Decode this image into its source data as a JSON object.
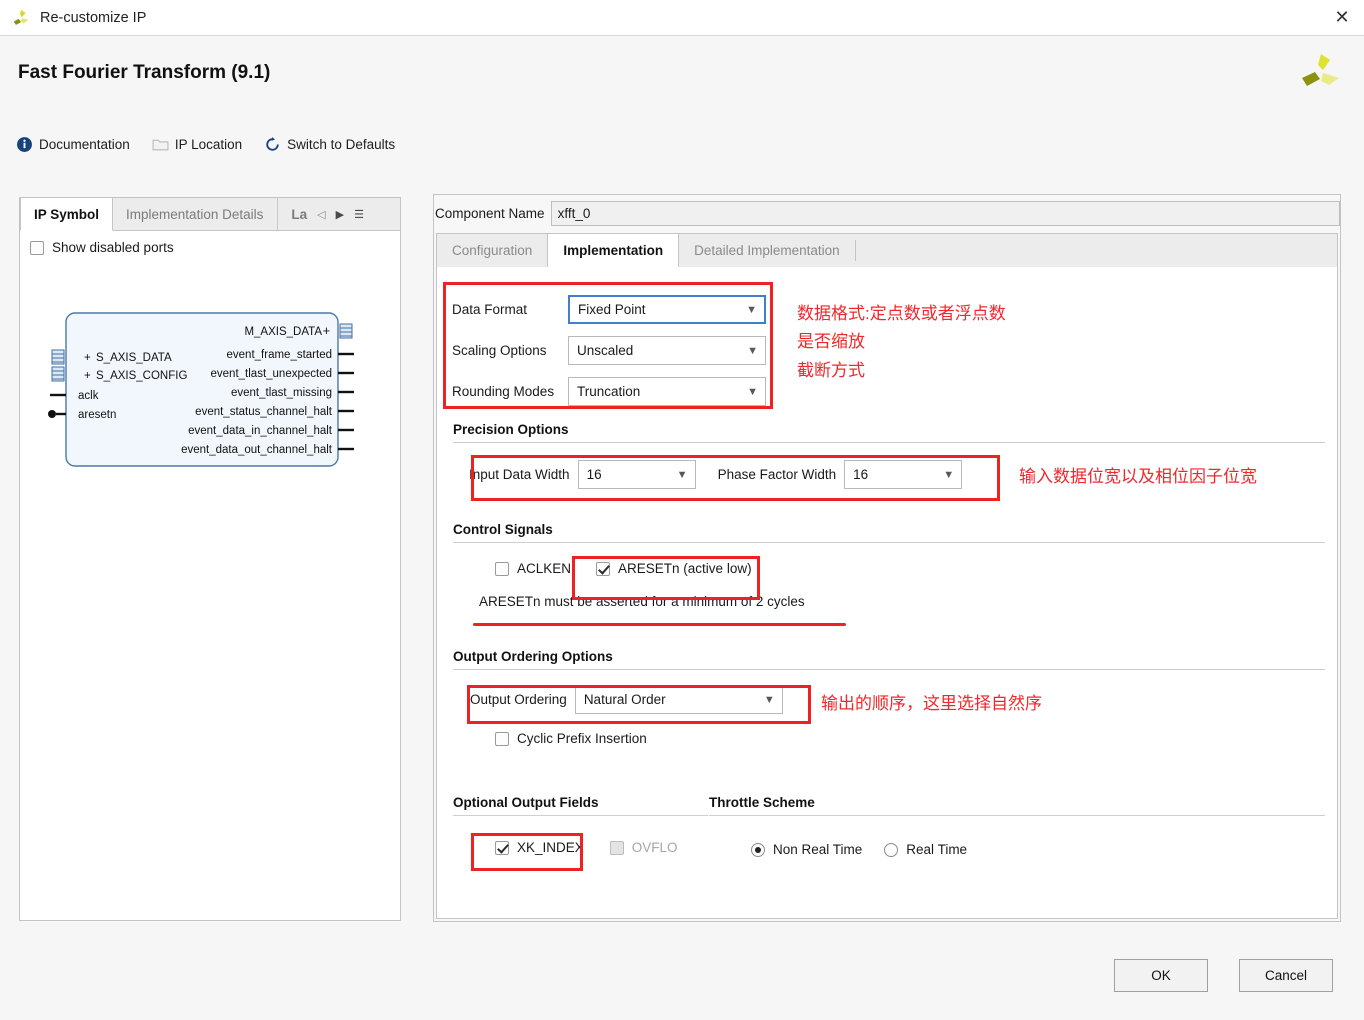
{
  "window": {
    "title": "Re-customize IP",
    "icon": "xilinx-logo-icon",
    "close_label": "✕"
  },
  "header": {
    "title": "Fast Fourier Transform (9.1)",
    "logo": "xilinx-logo"
  },
  "linkbar": {
    "items": [
      {
        "label": "Documentation",
        "icon": "info-icon"
      },
      {
        "label": "IP Location",
        "icon": "folder-icon"
      },
      {
        "label": "Switch to Defaults",
        "icon": "refresh-icon"
      }
    ]
  },
  "left_panel": {
    "tabs": [
      {
        "label": "IP Symbol",
        "active": true
      },
      {
        "label": "Implementation Details",
        "active": false
      },
      {
        "label": "La",
        "active": false,
        "truncated": true
      }
    ],
    "nav": {
      "prev": "◁",
      "next": "▶",
      "menu": "☰"
    },
    "show_disabled_ports": {
      "label": "Show disabled ports",
      "checked": false
    },
    "symbol": {
      "left_ports": [
        {
          "name": "S_AXIS_DATA",
          "kind": "bus"
        },
        {
          "name": "S_AXIS_CONFIG",
          "kind": "bus"
        },
        {
          "name": "aclk",
          "kind": "clock"
        },
        {
          "name": "aresetn",
          "kind": "reset-active-low"
        }
      ],
      "right_ports": [
        {
          "name": "M_AXIS_DATA",
          "kind": "bus"
        },
        {
          "name": "event_frame_started",
          "kind": "signal"
        },
        {
          "name": "event_tlast_unexpected",
          "kind": "signal"
        },
        {
          "name": "event_tlast_missing",
          "kind": "signal"
        },
        {
          "name": "event_status_channel_halt",
          "kind": "signal"
        },
        {
          "name": "event_data_in_channel_halt",
          "kind": "signal"
        },
        {
          "name": "event_data_out_channel_halt",
          "kind": "signal"
        }
      ]
    }
  },
  "right_panel": {
    "component_name": {
      "label": "Component Name",
      "value": "xfft_0"
    },
    "tabs": [
      {
        "label": "Configuration",
        "active": false
      },
      {
        "label": "Implementation",
        "active": true
      },
      {
        "label": "Detailed Implementation",
        "active": false
      }
    ],
    "implementation": {
      "data_format": {
        "label": "Data Format",
        "value": "Fixed Point",
        "focused": true
      },
      "scaling_options": {
        "label": "Scaling Options",
        "value": "Unscaled",
        "focused": false
      },
      "rounding_modes": {
        "label": "Rounding Modes",
        "value": "Truncation",
        "focused": false
      },
      "precision_options": {
        "title": "Precision Options",
        "input_data_width": {
          "label": "Input Data Width",
          "value": "16"
        },
        "phase_factor_width": {
          "label": "Phase Factor Width",
          "value": "16"
        }
      },
      "control_signals": {
        "title": "Control Signals",
        "aclken": {
          "label": "ACLKEN",
          "checked": false
        },
        "aresetn": {
          "label": "ARESETn (active low)",
          "checked": true
        },
        "note": "ARESETn must be asserted for a minimum of 2 cycles"
      },
      "output_ordering_options": {
        "title": "Output Ordering Options",
        "output_ordering": {
          "label": "Output Ordering",
          "value": "Natural Order"
        },
        "cyclic_prefix_insertion": {
          "label": "Cyclic Prefix Insertion",
          "checked": false
        }
      },
      "optional_output_fields": {
        "title": "Optional Output Fields",
        "xk_index": {
          "label": "XK_INDEX",
          "checked": true,
          "disabled": false
        },
        "ovflo": {
          "label": "OVFLO",
          "checked": false,
          "disabled": true
        }
      },
      "throttle_scheme": {
        "title": "Throttle Scheme",
        "options": [
          {
            "label": "Non Real Time",
            "selected": true
          },
          {
            "label": "Real Time",
            "selected": false
          }
        ]
      }
    }
  },
  "annotations": {
    "color": "#f2272c",
    "data_format_note_line1": "数据格式:定点数或者浮点数",
    "data_format_note_line2": "是否缩放",
    "data_format_note_line3": "截断方式",
    "precision_note": "输入数据位宽以及相位因子位宽",
    "output_ordering_note": "输出的顺序，这里选择自然序"
  },
  "footer": {
    "ok_label": "OK",
    "cancel_label": "Cancel"
  }
}
